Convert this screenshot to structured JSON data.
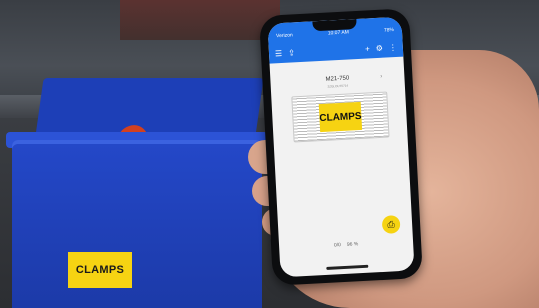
{
  "bin": {
    "label": "CLAMPS"
  },
  "phone": {
    "status_bar": {
      "left": "Verizon",
      "time": "10:07 AM",
      "battery": "78%"
    },
    "toolbar": {
      "menu": "☰",
      "upload": "⇪",
      "add": "+",
      "settings": "⚙",
      "more": "⋮"
    },
    "device_name": "M21-750",
    "device_sub": "2ZGLOUT0714",
    "label_text": "CLAMPS",
    "bottom_bar": {
      "info": "0/0",
      "zoom": "96 %"
    },
    "fab_icon": "print"
  }
}
